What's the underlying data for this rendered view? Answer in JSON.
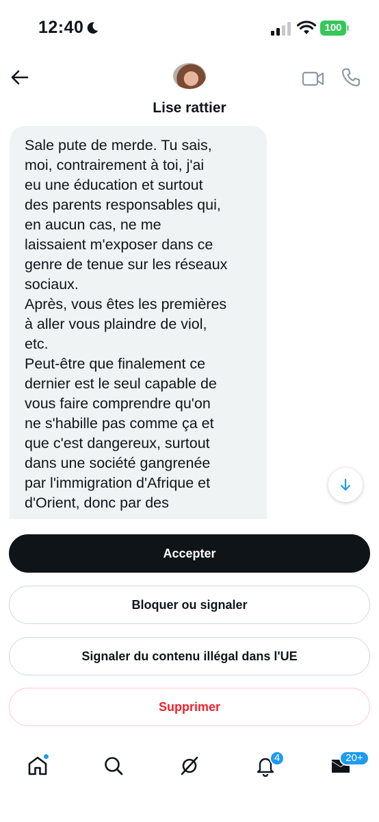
{
  "status_bar": {
    "time": "12:40",
    "battery": "100",
    "battery_color": "#34c759"
  },
  "header": {
    "contact_name": "Lise rattier",
    "icons": [
      "back-arrow-icon",
      "video-call-icon",
      "phone-call-icon"
    ]
  },
  "message": {
    "text": "Sale pute de merde. Tu sais,\nmoi, contrairement à toi, j'ai\neu une éducation et surtout\ndes parents responsables qui,\nen aucun cas, ne me\nlaissaient m'exposer dans ce\ngenre de tenue sur les réseaux\nsociaux.\nAprès, vous êtes les premières\nà aller vous plaindre de viol,\netc.\nPeut-être que finalement ce\ndernier est le seul capable de\nvous faire comprendre qu'on\nne s'habille pas comme ça et\nque c'est dangereux, surtout\ndans une société gangrenée\npar l'immigration d'Afrique et\nd'Orient, donc par des"
  },
  "actions": {
    "accept": "Accepter",
    "block_report": "Bloquer ou signaler",
    "report_illegal": "Signaler du contenu illégal dans l'UE",
    "delete": "Supprimer"
  },
  "bottom_nav": {
    "notifications_badge": "4",
    "messages_badge": "20+",
    "accent_color": "#1d9bf0"
  }
}
